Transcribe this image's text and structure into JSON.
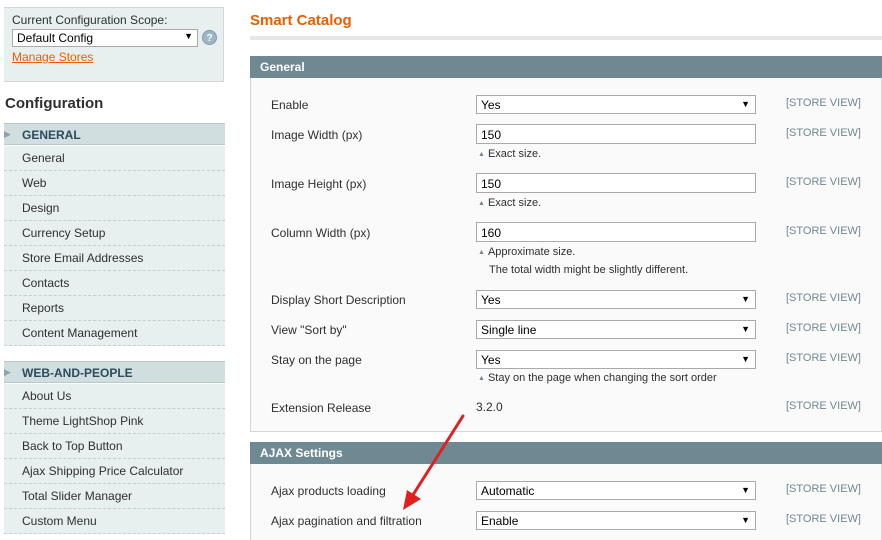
{
  "sidebar": {
    "scope_label": "Current Configuration Scope:",
    "scope_value": "Default Config",
    "help_icon": "?",
    "manage_stores": "Manage Stores",
    "config_title": "Configuration",
    "groups": [
      {
        "title": "GENERAL",
        "items": [
          "General",
          "Web",
          "Design",
          "Currency Setup",
          "Store Email Addresses",
          "Contacts",
          "Reports",
          "Content Management"
        ]
      },
      {
        "title": "WEB-AND-PEOPLE",
        "items": [
          "About Us",
          "Theme LightShop Pink",
          "Back to Top Button",
          "Ajax Shipping Price Calculator",
          "Total Slider Manager",
          "Custom Menu"
        ]
      }
    ]
  },
  "main": {
    "title": "Smart Catalog",
    "sections": [
      {
        "title": "General",
        "fields": {
          "enable": {
            "label": "Enable",
            "value": "Yes",
            "scope": "[STORE VIEW]"
          },
          "image_width": {
            "label": "Image Width (px)",
            "value": "150",
            "note": "Exact size.",
            "scope": "[STORE VIEW]"
          },
          "image_height": {
            "label": "Image Height (px)",
            "value": "150",
            "note": "Exact size.",
            "scope": "[STORE VIEW]"
          },
          "column_width": {
            "label": "Column Width (px)",
            "value": "160",
            "note": "Approximate size.",
            "note2": "The total width might be slightly different.",
            "scope": "[STORE VIEW]"
          },
          "display_short_desc": {
            "label": "Display Short Description",
            "value": "Yes",
            "scope": "[STORE VIEW]"
          },
          "view_sort_by": {
            "label": "View \"Sort by\"",
            "value": "Single line",
            "scope": "[STORE VIEW]"
          },
          "stay_on_page": {
            "label": "Stay on the page",
            "value": "Yes",
            "note": "Stay on the page when changing the sort order",
            "scope": "[STORE VIEW]"
          },
          "extension_release": {
            "label": "Extension Release",
            "value": "3.2.0",
            "scope": "[STORE VIEW]"
          }
        }
      },
      {
        "title": "AJAX Settings",
        "fields": {
          "ajax_products_loading": {
            "label": "Ajax products loading",
            "value": "Automatic",
            "scope": "[STORE VIEW]"
          },
          "ajax_pagination": {
            "label": "Ajax pagination and filtration",
            "value": "Enable",
            "scope": "[STORE VIEW]"
          }
        }
      }
    ]
  },
  "icons": {
    "dropdown_arrow": "▼",
    "note_arrow": "▲",
    "group_triangle": "▶"
  },
  "colors": {
    "accent_orange": "#eb5e00",
    "section_header": "#6f8992",
    "sidebar_bg": "#e7efef",
    "group_header_bg": "#d1dedf",
    "annotation_arrow": "#e02020"
  }
}
